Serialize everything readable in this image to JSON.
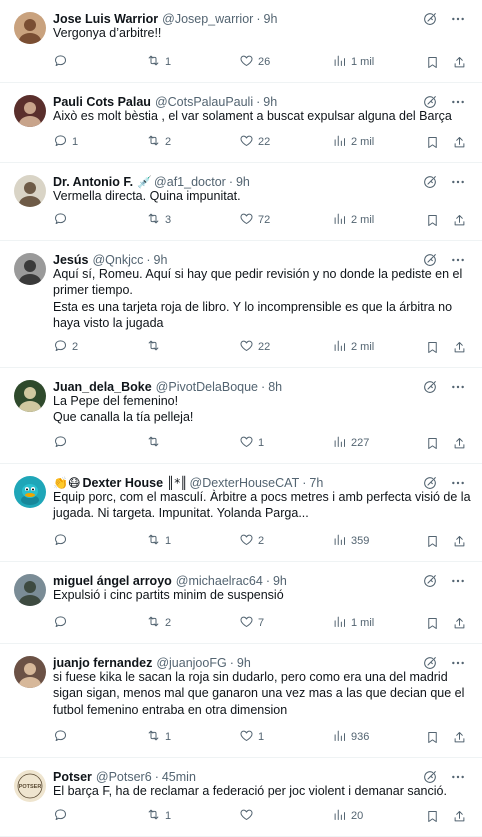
{
  "tweets": [
    {
      "name": "Jose Luis Warrior",
      "badge": "",
      "handle": "@Josep_warrior",
      "time": "9h",
      "lines": [
        "Vergonya d’arbitre!!"
      ],
      "replies": "",
      "retweets": "1",
      "likes": "26",
      "views": "1 mil"
    },
    {
      "name": "Pauli Cots Palau",
      "badge": "",
      "handle": "@CotsPalauPauli",
      "time": "9h",
      "lines": [
        "Això es molt bèstia , el var solament a buscat expulsar alguna del Barça"
      ],
      "replies": "1",
      "retweets": "2",
      "likes": "22",
      "views": "2 mil"
    },
    {
      "name": "Dr. Antonio F.",
      "badge": "💉",
      "handle": "@af1_doctor",
      "time": "9h",
      "lines": [
        "Vermella directa. Quina impunitat."
      ],
      "replies": "",
      "retweets": "3",
      "likes": "72",
      "views": "2 mil"
    },
    {
      "name": "Jesús",
      "badge": "",
      "handle": "@Qnkjcc",
      "time": "9h",
      "lines": [
        "Aquí sí, Romeu. Aquí si hay que pedir revisión y no donde la pediste en el",
        "primer tiempo.",
        "Esta es una tarjeta roja de libro. Y lo incomprensible es que la árbitra no",
        "haya visto la jugada"
      ],
      "replies": "2",
      "retweets": "",
      "likes": "22",
      "views": "2 mil"
    },
    {
      "name": "Juan_dela_Boke",
      "badge": "",
      "handle": "@PivotDelaBoque",
      "time": "8h",
      "lines": [
        "La Pepe del femenino!",
        "Que canalla la tía pelleja!"
      ],
      "replies": "",
      "retweets": "",
      "likes": "1",
      "views": "227"
    },
    {
      "name": "Dexter House",
      "name_prefix": "👏😷",
      "badge": "║*║",
      "handle": "@DexterHouseCAT",
      "time": "7h",
      "lines": [
        "Equip porc, com el masculí. Àrbitre a pocs metres i amb perfecta visió de la",
        "jugada. Ni targeta. Impunitat. Yolanda Parga..."
      ],
      "replies": "",
      "retweets": "1",
      "likes": "2",
      "views": "359"
    },
    {
      "name": "miguel ángel arroyo",
      "badge": "",
      "handle": "@michaelrac64",
      "time": "9h",
      "lines": [
        "Expulsió i cinc partits minim de suspensió"
      ],
      "replies": "",
      "retweets": "2",
      "likes": "7",
      "views": "1 mil"
    },
    {
      "name": "juanjo fernandez",
      "badge": "",
      "handle": "@juanjooFG",
      "time": "9h",
      "lines": [
        "si fuese kika le sacan la roja sin dudarlo, pero como era una del madrid",
        "sigan sigan, menos mal que ganaron una vez mas a las que decian que el",
        "futbol femenino entraba en otra dimension"
      ],
      "replies": "",
      "retweets": "1",
      "likes": "1",
      "views": "936"
    },
    {
      "name": "Potser",
      "badge": "",
      "handle": "@Potser6",
      "time": "45min",
      "lines": [
        "El barça F, ha de reclamar a federació per joc violent i demanar sanció."
      ],
      "replies": "",
      "retweets": "1",
      "likes": "",
      "views": "20"
    }
  ],
  "avatars": [
    {
      "icon": "avatar-photo",
      "bg": "#c9a27e",
      "fg": "#7a4e33"
    },
    {
      "icon": "avatar-photo",
      "bg": "#5a2f2c",
      "fg": "#c8a48b"
    },
    {
      "icon": "avatar-photo",
      "bg": "#d9d4c6",
      "fg": "#6e5b47"
    },
    {
      "icon": "avatar-photo",
      "bg": "#9a9a9a",
      "fg": "#3a3a3a"
    },
    {
      "icon": "avatar-photo",
      "bg": "#2f4a2c",
      "fg": "#d0c8a0"
    },
    {
      "icon": "avatar-perry",
      "bg": "#1fa6b8",
      "fg": "#f0a500"
    },
    {
      "icon": "avatar-photo",
      "bg": "#7a8c96",
      "fg": "#3d4a40"
    },
    {
      "icon": "avatar-photo",
      "bg": "#6b5145",
      "fg": "#d7b89a"
    },
    {
      "icon": "avatar-potser",
      "bg": "#efe5cf",
      "fg": "#5a4a33",
      "text": "POTSER"
    }
  ],
  "colors": {
    "text_primary": "#0f1419",
    "text_secondary": "#536471",
    "divider": "#eff3f4"
  }
}
